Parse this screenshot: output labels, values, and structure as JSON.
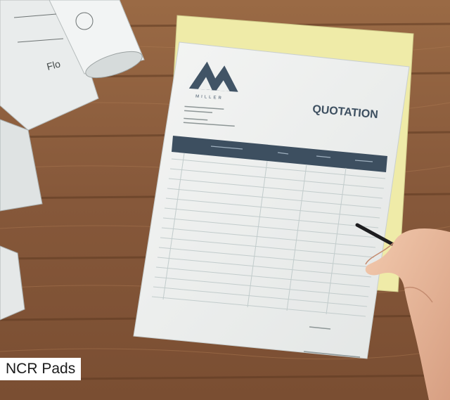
{
  "caption": "NCR Pads",
  "document": {
    "title": "QUOTATION",
    "brand": "MILLER"
  },
  "colors": {
    "wood_base": "#8a5a38",
    "wood_dark": "#5e3a22",
    "paper_top": "#eef0ef",
    "paper_yellow": "#efeba8",
    "table_header": "#3d4f60",
    "caption_bg": "#ffffff"
  }
}
